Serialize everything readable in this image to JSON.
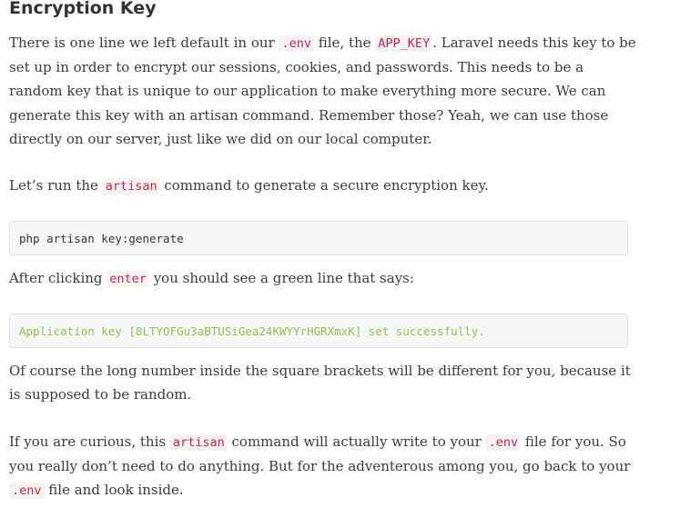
{
  "article": {
    "title": "Encryption Key",
    "p1": {
      "t1": "There is one line we left default in our ",
      "c1": ".env",
      "t2": " file, the ",
      "c2": "APP_KEY",
      "t3": ". Laravel needs this key to be set up in order to encrypt our sessions, cookies, and passwords. This needs to be a random key that is unique to our application to make everything more secure. We can generate this key with an artisan command. Remember those? Yeah, we can use those directly on our server, just like we did on our local computer."
    },
    "p2": {
      "t1": "Let’s run the ",
      "c1": "artisan",
      "t2": " command to generate a secure encryption key."
    },
    "code1": "php artisan key:generate",
    "p3": {
      "t1": "After clicking ",
      "c1": "enter",
      "t2": " you should see a green line that says:"
    },
    "code2": "Application key [8LTYOFGu3aBTUSiGea24KWYYrHGRXmxK] set successfully.",
    "p4": "Of course the long number inside the square brackets will be different for you, because it is supposed to be random.",
    "p5": {
      "t1": "If you are curious, this ",
      "c1": "artisan",
      "t2": " command will actually write to your ",
      "c2": ".env",
      "t3": " file for you. So you really don’t need to do anything. But for the adventerous among you, go back to your ",
      "c3": ".env",
      "t4": " file and look inside."
    }
  },
  "colors": {
    "inline_code": "#c7254e",
    "success_text": "#8bc34a",
    "code_bg": "#f7f7f7"
  }
}
